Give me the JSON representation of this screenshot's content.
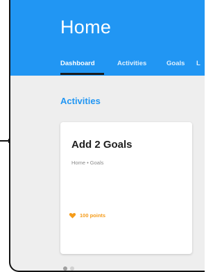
{
  "header": {
    "title": "Home",
    "tabs": [
      {
        "label": "Dashboard",
        "active": true
      },
      {
        "label": "Activities",
        "active": false
      },
      {
        "label": "Goals",
        "active": false
      },
      {
        "label": "L",
        "active": false
      }
    ]
  },
  "main": {
    "section_title": "Activities",
    "card": {
      "title": "Add 2 Goals",
      "breadcrumb": "Home • Goals",
      "points_label": "100 points",
      "points_icon": "heart-icon"
    },
    "pagination": {
      "total": 2,
      "current": 1
    }
  },
  "colors": {
    "appbar": "#2196f3",
    "accent": "#2196f3",
    "points": "#f59c1a",
    "background": "#eeeeee"
  }
}
